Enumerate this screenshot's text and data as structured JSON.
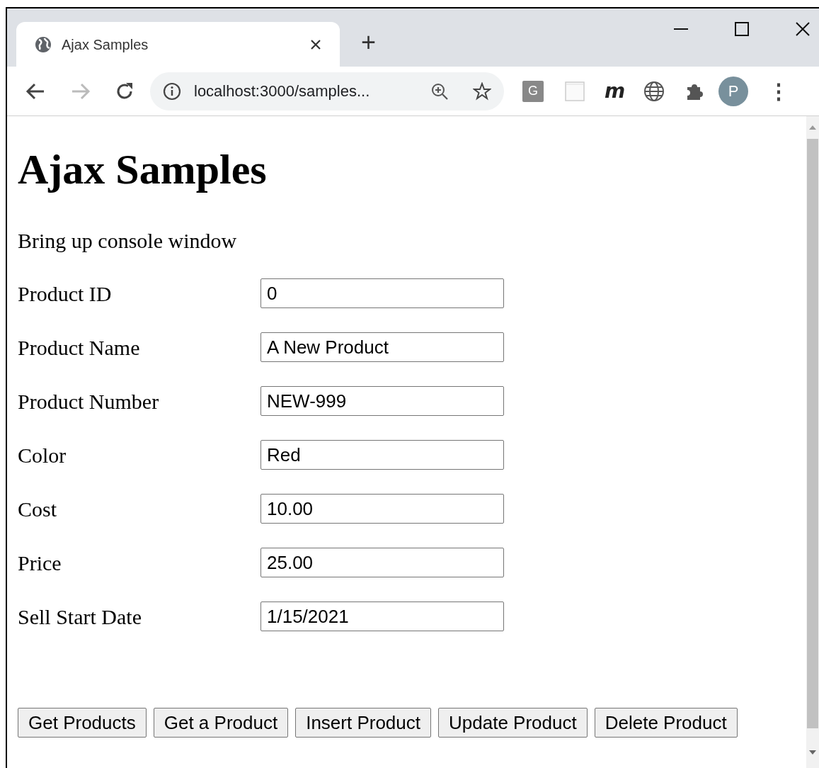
{
  "browser": {
    "tab_title": "Ajax Samples",
    "new_tab": "+",
    "address": "localhost:3000/samples...",
    "extension_letter": "G",
    "extension_m": "m",
    "profile_initial": "P",
    "menu": "⋮"
  },
  "page": {
    "heading": "Ajax Samples",
    "link_text": "Bring up console window",
    "fields": [
      {
        "label": "Product ID",
        "value": "0"
      },
      {
        "label": "Product Name",
        "value": "A New Product"
      },
      {
        "label": "Product Number",
        "value": "NEW-999"
      },
      {
        "label": "Color",
        "value": "Red"
      },
      {
        "label": "Cost",
        "value": "10.00"
      },
      {
        "label": "Price",
        "value": "25.00"
      },
      {
        "label": "Sell Start Date",
        "value": "1/15/2021"
      }
    ],
    "buttons": [
      "Get Products",
      "Get a Product",
      "Insert Product",
      "Update Product",
      "Delete Product"
    ]
  }
}
